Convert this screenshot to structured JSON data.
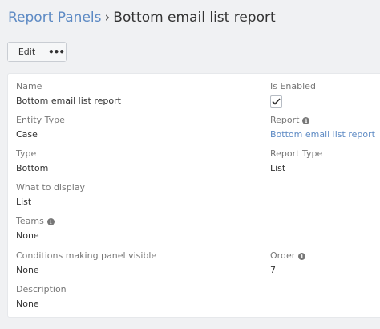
{
  "breadcrumb": {
    "parent": "Report Panels",
    "separator": "›",
    "current": "Bottom email list report"
  },
  "toolbar": {
    "edit_label": "Edit",
    "more_label": "•••"
  },
  "fields": {
    "name": {
      "label": "Name",
      "value": "Bottom email list report"
    },
    "is_enabled": {
      "label": "Is Enabled",
      "checked": true
    },
    "entity_type": {
      "label": "Entity Type",
      "value": "Case"
    },
    "report": {
      "label": "Report",
      "value": "Bottom email list report"
    },
    "type": {
      "label": "Type",
      "value": "Bottom"
    },
    "report_type": {
      "label": "Report Type",
      "value": "List"
    },
    "what_to_display": {
      "label": "What to display",
      "value": "List"
    },
    "teams": {
      "label": "Teams",
      "value": "None"
    },
    "conditions": {
      "label": "Conditions making panel visible",
      "value": "None"
    },
    "order": {
      "label": "Order",
      "value": "7"
    },
    "description": {
      "label": "Description",
      "value": "None"
    }
  },
  "icons": {
    "info": "info-icon",
    "check": "check-icon",
    "more": "ellipsis-icon"
  },
  "colors": {
    "link": "#5d8ac4",
    "background": "#f0f1f3",
    "panel": "#ffffff",
    "label": "#777777"
  }
}
